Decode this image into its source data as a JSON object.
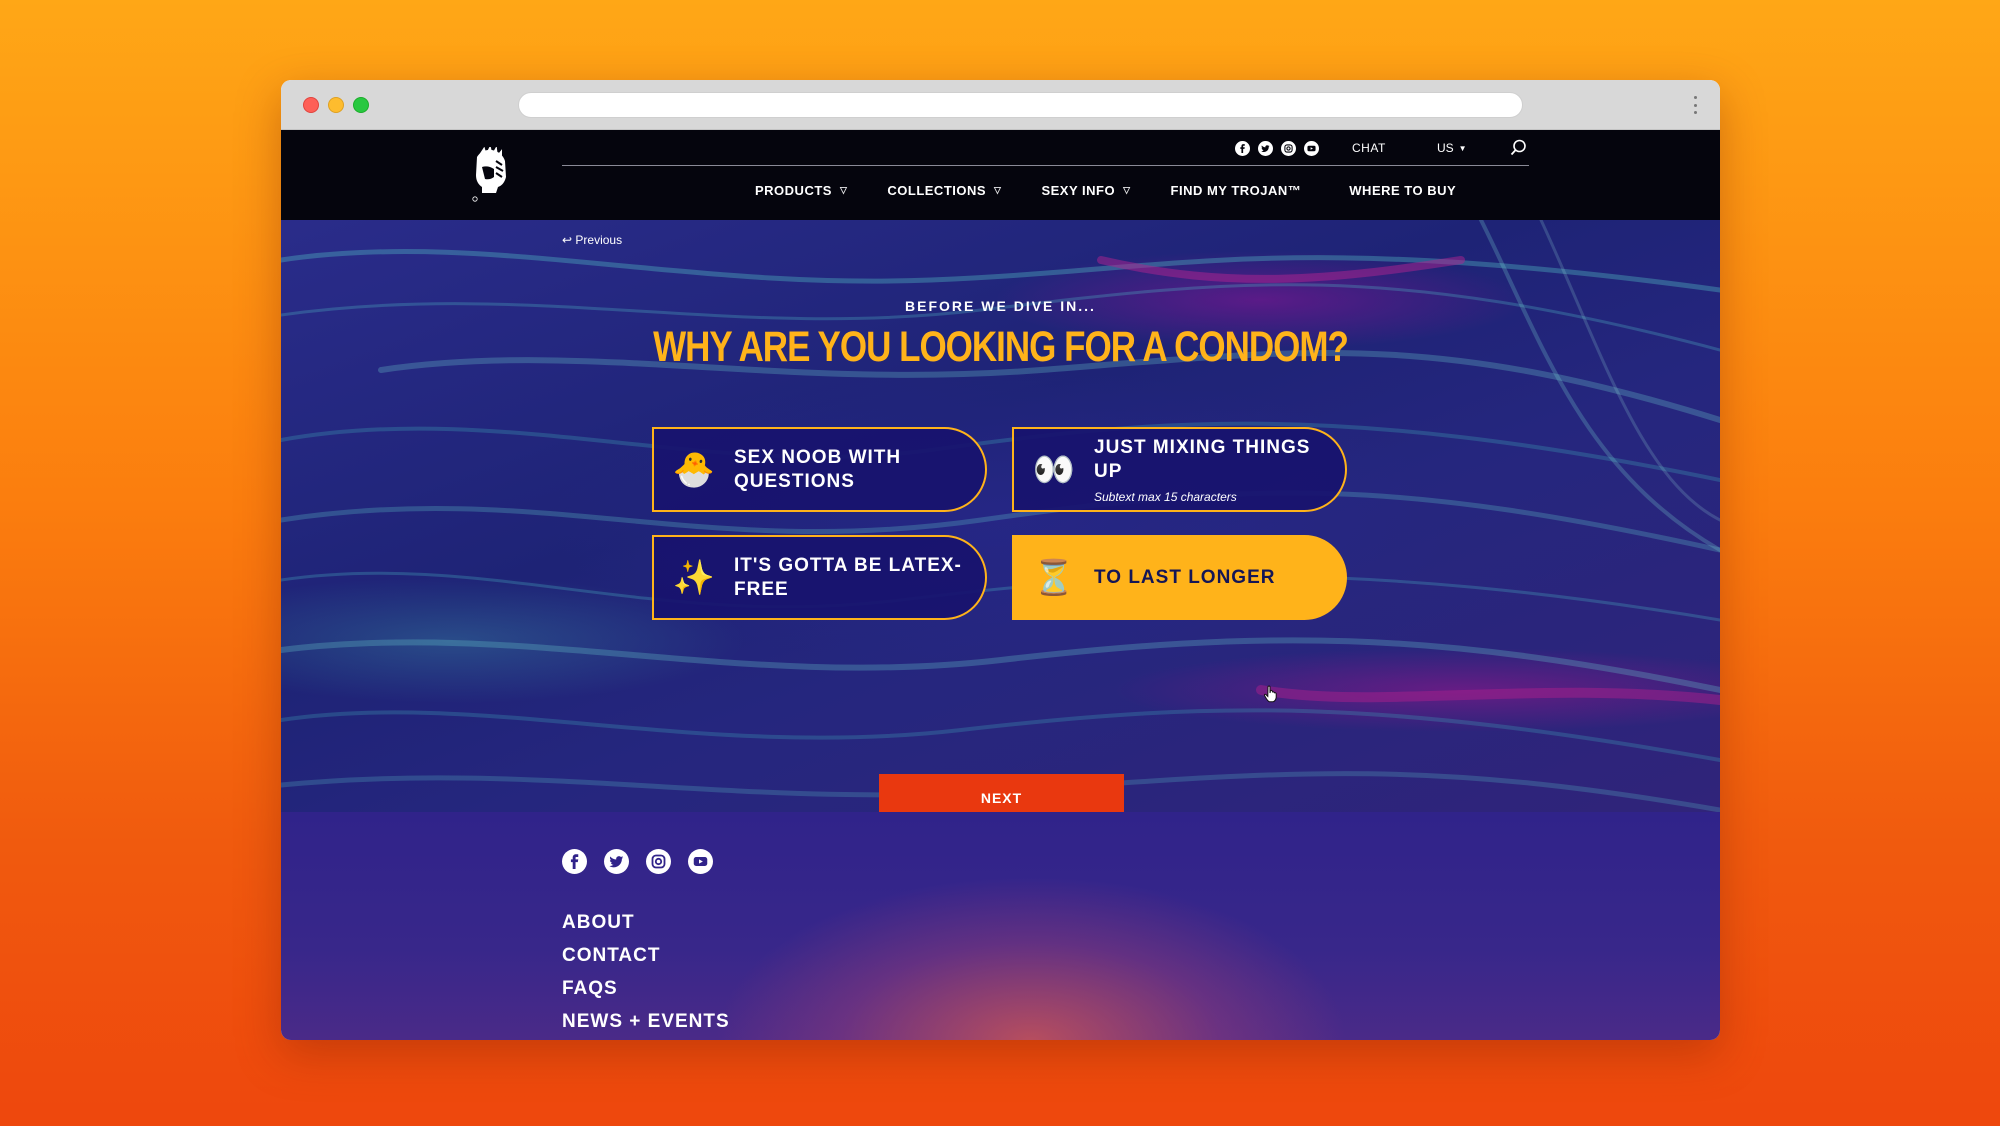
{
  "top_bar": {
    "chat": "CHAT",
    "locale": "US",
    "social_icons": [
      "facebook-icon",
      "twitter-icon",
      "instagram-icon",
      "youtube-icon"
    ]
  },
  "nav": {
    "products": "PRODUCTS",
    "collections": "COLLECTIONS",
    "sexy_info": "SEXY INFO",
    "find_my_trojan": "FIND MY TROJAN™",
    "where_to_buy": "WHERE TO BUY"
  },
  "quiz": {
    "previous": "↩ Previous",
    "eyebrow": "BEFORE WE DIVE IN...",
    "question": "WHY ARE YOU LOOKING FOR A CONDOM?",
    "options": [
      {
        "emoji": "🐣",
        "label": "SEX NOOB WITH QUESTIONS",
        "subtext": "",
        "selected": false
      },
      {
        "emoji": "👀",
        "label": "JUST MIXING THINGS UP",
        "subtext": "Subtext max 15 characters",
        "selected": false
      },
      {
        "emoji": "✨",
        "label": "IT'S GOTTA BE LATEX-FREE",
        "subtext": "",
        "selected": false
      },
      {
        "emoji": "⏳",
        "label": "TO LAST LONGER",
        "subtext": "",
        "selected": true
      }
    ],
    "next": "NEXT"
  },
  "footer": {
    "links": [
      "ABOUT",
      "CONTACT",
      "FAQS",
      "NEWS + EVENTS"
    ],
    "social_icons": [
      "facebook-icon",
      "twitter-icon",
      "instagram-icon",
      "youtube-icon"
    ]
  },
  "colors": {
    "accent_yellow": "#ffb31a",
    "cta_red": "#e9380f",
    "header_black": "#05050d",
    "hero_blue": "#1e2376",
    "page_bg_orange": "#fb7d0e"
  }
}
